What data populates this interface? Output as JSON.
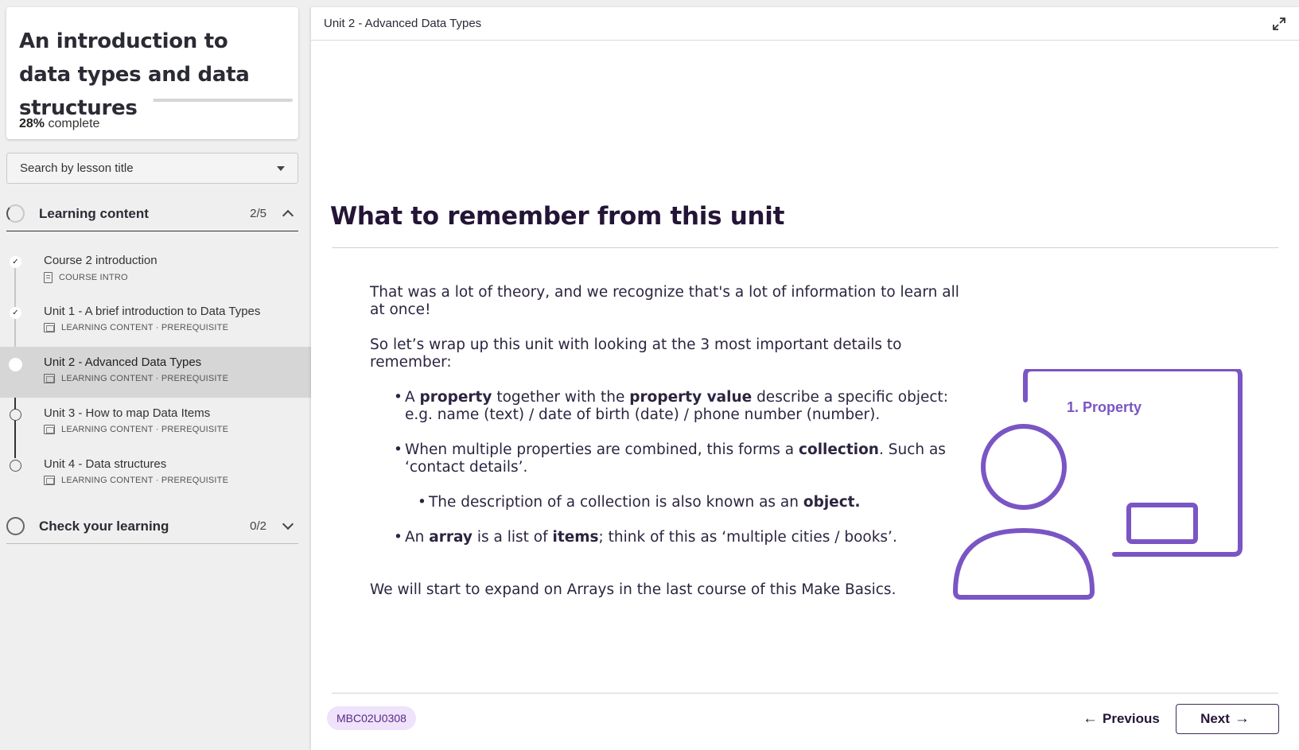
{
  "sidebar": {
    "course_title": "An introduction to data types and data structures",
    "progress_percent": "28%",
    "progress_value": 0.28,
    "progress_suffix": "complete",
    "search_placeholder": "Search by lesson title",
    "sections": [
      {
        "label": "Learning content",
        "count": "2/5",
        "expanded": true,
        "lessons": [
          {
            "title": "Course 2 introduction",
            "meta": "COURSE INTRO",
            "status": "complete"
          },
          {
            "title": "Unit 1 - A brief introduction to Data Types",
            "meta": "LEARNING CONTENT · PREREQUISITE",
            "status": "complete"
          },
          {
            "title": "Unit 2 - Advanced Data Types",
            "meta": "LEARNING CONTENT · PREREQUISITE",
            "status": "current"
          },
          {
            "title": "Unit 3 - How to map Data Items",
            "meta": "LEARNING CONTENT · PREREQUISITE",
            "status": "open"
          },
          {
            "title": "Unit 4 - Data structures",
            "meta": "LEARNING CONTENT · PREREQUISITE",
            "status": "open"
          }
        ]
      },
      {
        "label": "Check your learning",
        "count": "0/2",
        "expanded": false
      }
    ]
  },
  "main": {
    "breadcrumb": "Unit 2 - Advanced Data Types",
    "title": "What to remember from this unit",
    "intro_1": "That was a lot of theory, and we recognize that's a lot of information to learn all at once!",
    "intro_2": "So let’s wrap up this unit with looking at the 3 most important details to remember:",
    "bullet_1": {
      "p1": "A ",
      "b1": "property",
      "p2": " together with the ",
      "b2": "property value",
      "p3": " describe a specific object: e.g. name (text) / date of birth (date) / phone number (number)."
    },
    "bullet_2": {
      "p1": "When multiple properties are combined, this forms a ",
      "b1": "collection",
      "p2": ". Such as ‘contact details’."
    },
    "bullet_2_sub": {
      "p1": "The description of a collection is also known as an ",
      "b1": "object."
    },
    "bullet_3": {
      "p1": "An ",
      "b1": "array",
      "p2": " is a list of ",
      "b2": "items",
      "p3": "; think of this as ‘multiple cities / books’."
    },
    "closing": "We will start to expand on Arrays in the last course of this Make Basics.",
    "illustration_label": "1. Property",
    "illustration_color": "#7a55c4",
    "code": "MBC02U0308",
    "prev_label": "Previous",
    "next_label": "Next"
  }
}
